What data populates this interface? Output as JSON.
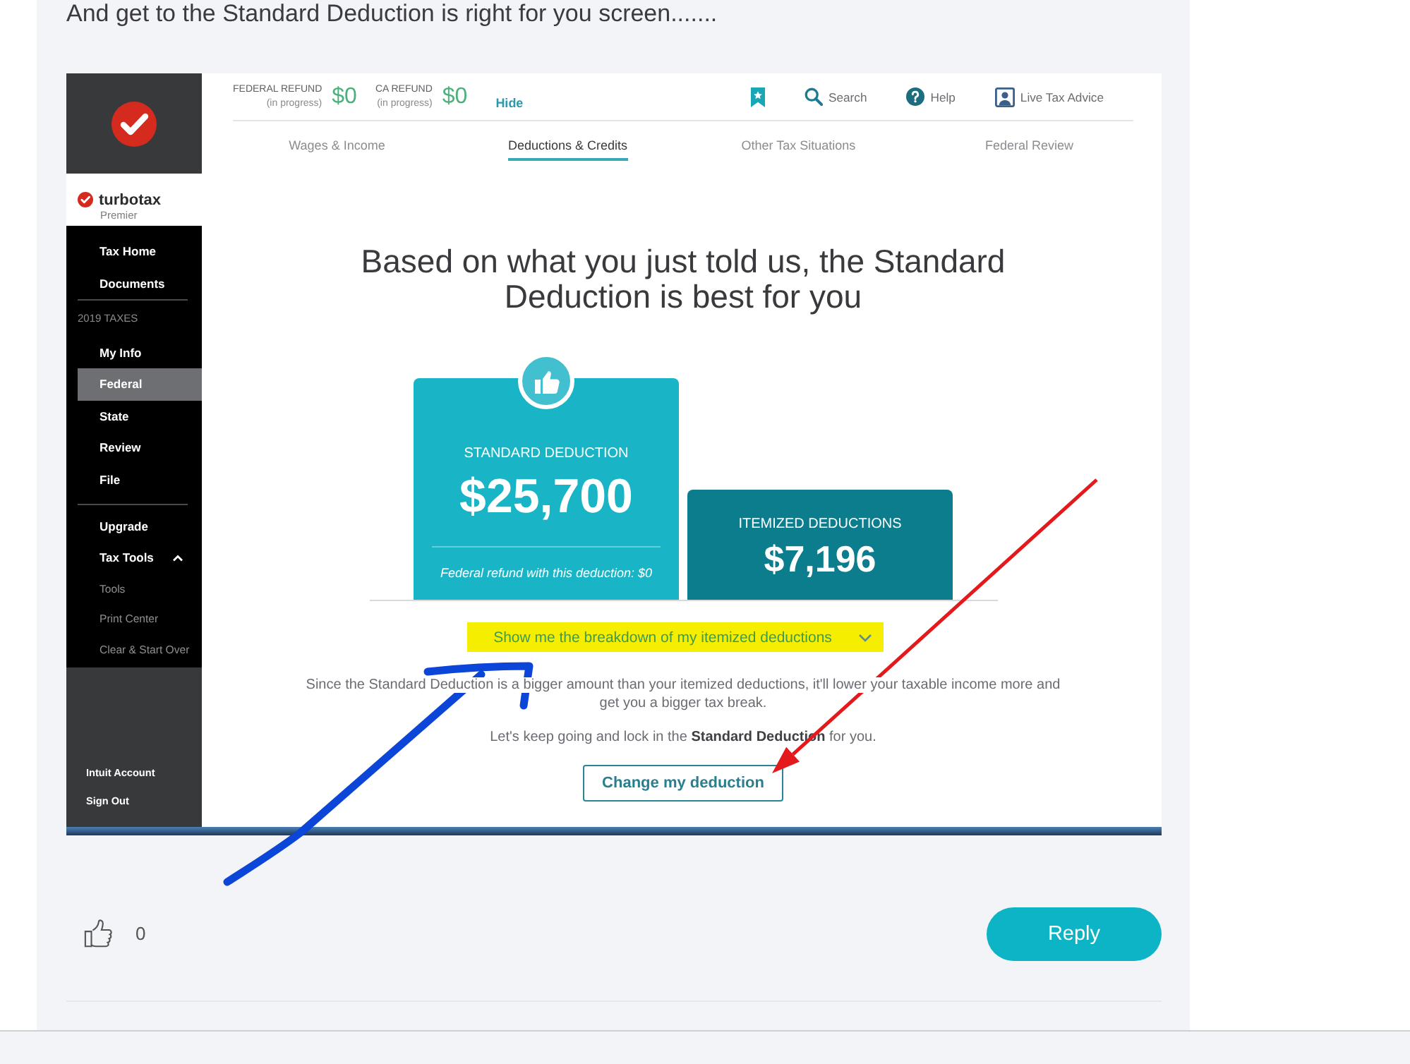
{
  "post": {
    "text": "And get to the Standard Deduction is right for you screen......."
  },
  "app": {
    "sidebar": {
      "brand": {
        "name": "turbotax",
        "edition": "Premier"
      },
      "sections": [
        {
          "items": [
            {
              "label": "Tax Home",
              "selected": false
            },
            {
              "label": "Documents",
              "selected": false
            }
          ]
        },
        {
          "heading": "2019 TAXES",
          "items": [
            {
              "label": "My Info",
              "selected": false
            },
            {
              "label": "Federal",
              "selected": true
            },
            {
              "label": "State",
              "selected": false
            },
            {
              "label": "Review",
              "selected": false
            },
            {
              "label": "File",
              "selected": false
            }
          ]
        },
        {
          "items": [
            {
              "label": "Upgrade",
              "selected": false
            },
            {
              "label": "Tax Tools",
              "selected": false,
              "expanded": true,
              "children": [
                {
                  "label": "Tools",
                  "selected": false
                },
                {
                  "label": "Print Center",
                  "selected": false
                },
                {
                  "label": "Clear & Start Over",
                  "selected": false
                }
              ]
            }
          ]
        }
      ],
      "footer": [
        {
          "label": "Intuit Account"
        },
        {
          "label": "Sign Out"
        }
      ]
    },
    "header": {
      "refunds": [
        {
          "label": "FEDERAL REFUND",
          "status": "(in progress)",
          "amount": "$0"
        },
        {
          "label": "CA REFUND",
          "status": "(in progress)",
          "amount": "$0"
        }
      ],
      "hide_link": "Hide",
      "tools": [
        {
          "kind": "bookmark"
        },
        {
          "kind": "search",
          "label": "Search"
        },
        {
          "kind": "help",
          "label": "Help"
        },
        {
          "kind": "advisor",
          "label": "Live Tax Advice"
        }
      ]
    },
    "tabs": [
      {
        "label": "Wages & Income",
        "selected": false
      },
      {
        "label": "Deductions & Credits",
        "selected": true
      },
      {
        "label": "Other Tax Situations",
        "selected": false
      },
      {
        "label": "Federal Review",
        "selected": false
      }
    ],
    "content": {
      "heading": "Based on what you just told us, the Standard Deduction is best for you",
      "cards": [
        {
          "recommended": true,
          "label": "STANDARD DEDUCTION",
          "amount": "$25,700",
          "note": "Federal refund with this deduction: $0"
        },
        {
          "recommended": false,
          "label": "ITEMIZED DEDUCTIONS",
          "amount": "$7,196"
        }
      ],
      "breakdown": {
        "label": "Show me the breakdown of my itemized deductions",
        "highlighted": true,
        "expanded": false
      },
      "explanation": "Since the Standard Deduction is a bigger amount than your itemized deductions, it'll lower your taxable income more and get you a bigger tax break.",
      "prompt": "Let's keep going and lock in the **Standard Deduction** for you.",
      "action": "Change my deduction"
    }
  },
  "annotations": [
    {
      "kind": "freehand-arrow",
      "color": "#0b46d8"
    },
    {
      "kind": "straight-arrow",
      "color": "#e3191c"
    }
  ],
  "footer": {
    "likes": "0",
    "reply": "Reply"
  }
}
